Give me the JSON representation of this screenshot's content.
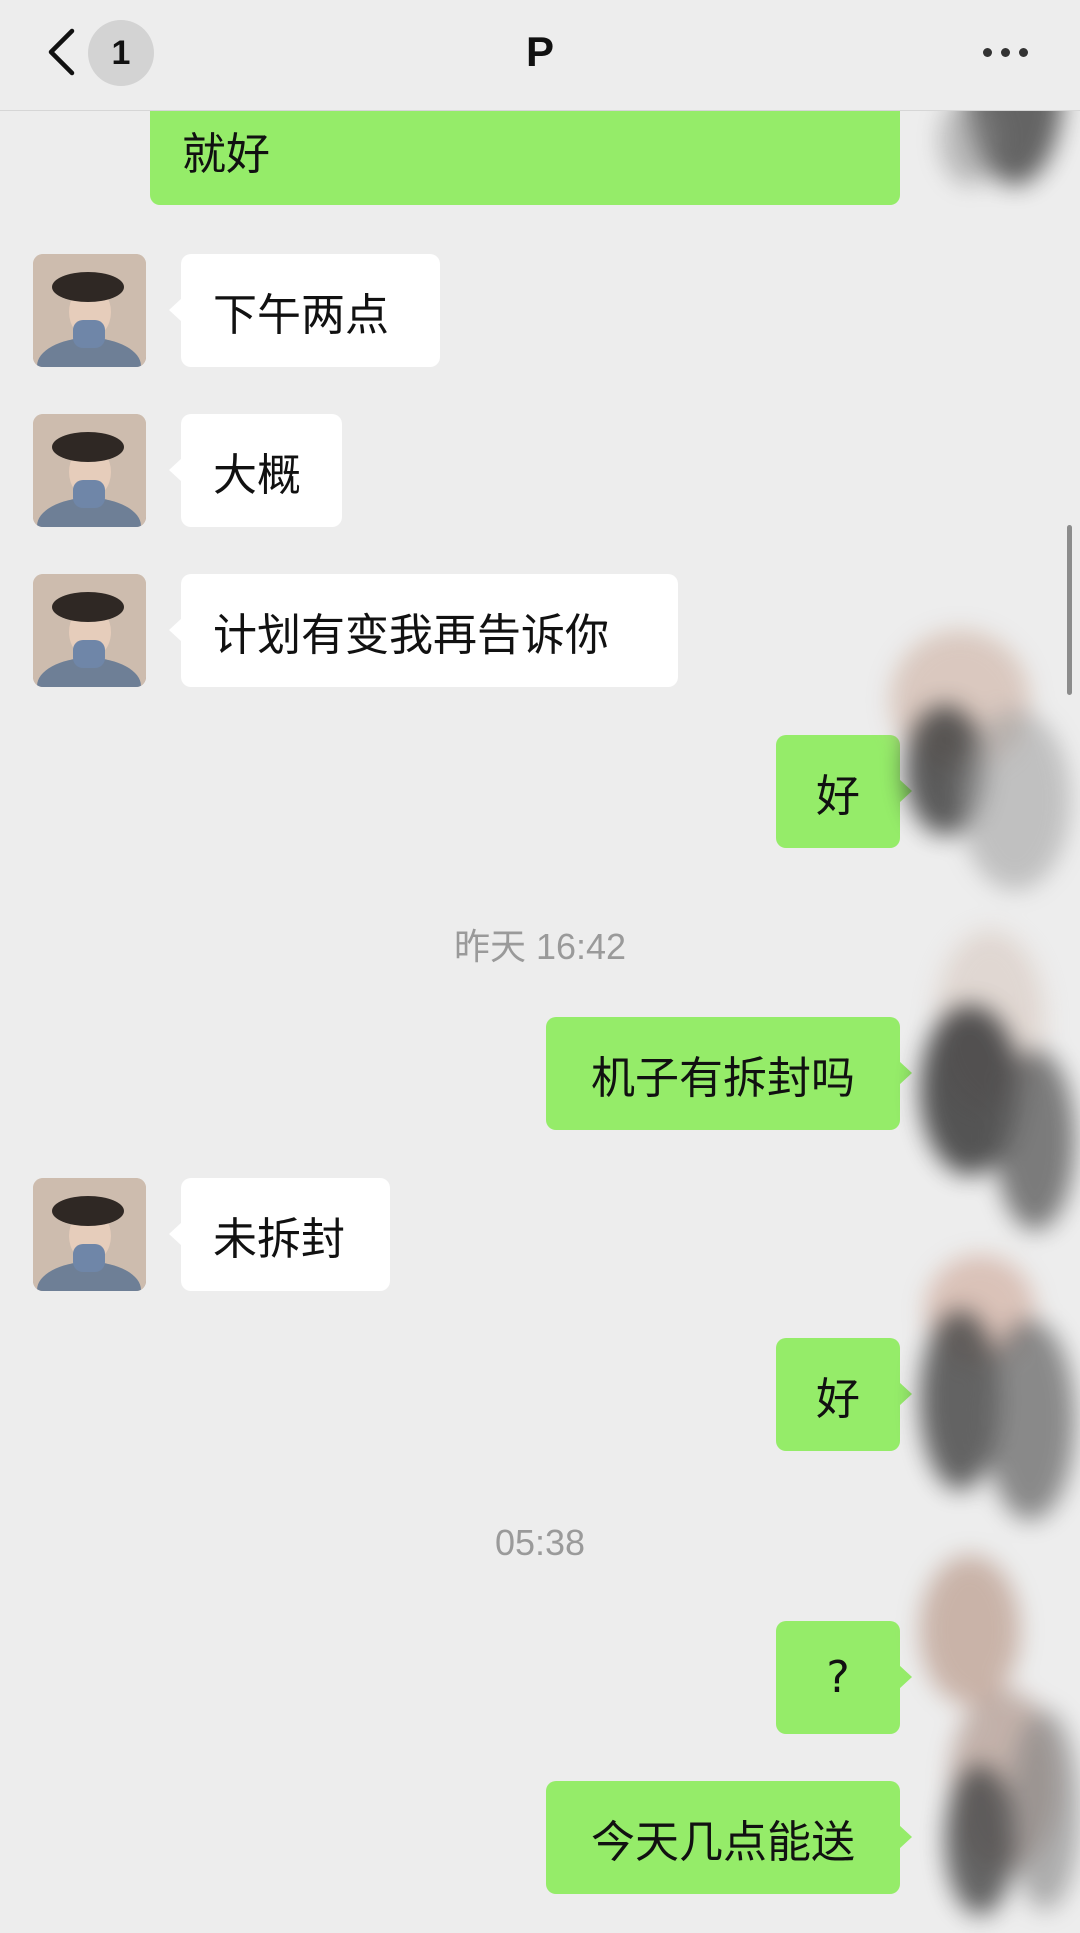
{
  "header": {
    "title": "P",
    "unread_count": "1",
    "back_icon": "chevron-left-icon",
    "more_icon": "more-dots-icon"
  },
  "messages": [
    {
      "direction": "out",
      "text": "就好"
    },
    {
      "direction": "in",
      "text": "下午两点"
    },
    {
      "direction": "in",
      "text": "大概"
    },
    {
      "direction": "in",
      "text": "计划有变我再告诉你"
    },
    {
      "direction": "out",
      "text": "好"
    },
    {
      "direction": "out",
      "text": "机子有拆封吗"
    },
    {
      "direction": "in",
      "text": "未拆封"
    },
    {
      "direction": "out",
      "text": "好"
    },
    {
      "direction": "out",
      "text": "?"
    },
    {
      "direction": "out",
      "text": "今天几点能送"
    }
  ],
  "timestamps": [
    "昨天 16:42",
    "05:38"
  ],
  "colors": {
    "background": "#ededed",
    "outgoing_bubble": "#95ec69",
    "incoming_bubble": "#ffffff",
    "timestamp_text": "#9a9a9a"
  }
}
